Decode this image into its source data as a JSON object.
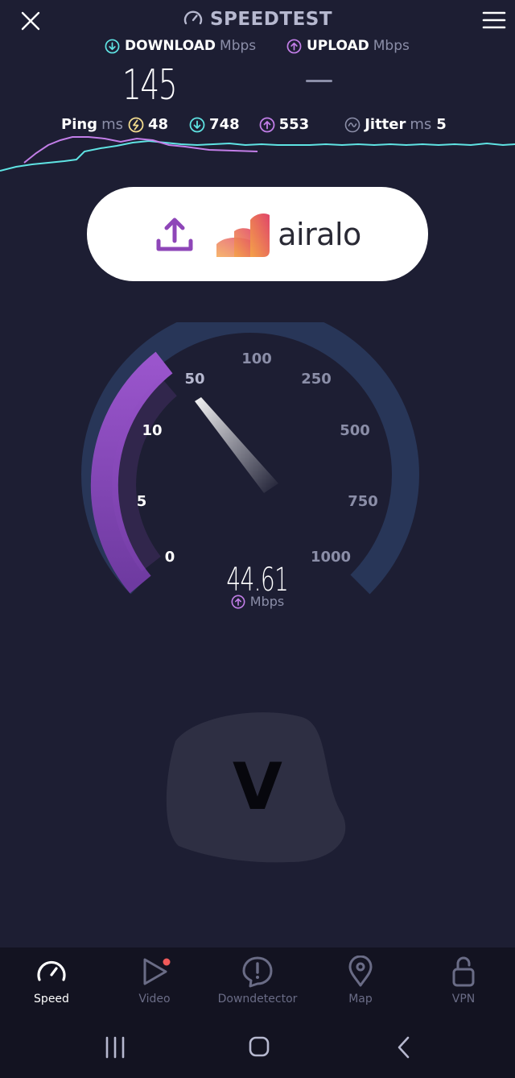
{
  "header": {
    "title": "SPEEDTEST",
    "close_icon": "close-icon",
    "menu_icon": "hamburger-menu-icon"
  },
  "results": {
    "download_label": "DOWNLOAD",
    "download_unit": "Mbps",
    "download_value": "145",
    "upload_label": "UPLOAD",
    "upload_unit": "Mbps",
    "upload_value": "—"
  },
  "stats": {
    "ping_label": "Ping",
    "ping_unit": "ms",
    "ping_value": "48",
    "download_ping": "748",
    "upload_ping": "553",
    "jitter_label": "Jitter",
    "jitter_unit": "ms",
    "jitter_value": "5"
  },
  "ad": {
    "brand": "airalo"
  },
  "gauge": {
    "ticks": [
      "0",
      "5",
      "10",
      "50",
      "100",
      "250",
      "500",
      "750",
      "1000"
    ],
    "current_value": "44.61",
    "unit": "Mbps",
    "colors": {
      "active": "#8e4fc0",
      "track": "#283658",
      "needle": "#ffffff"
    }
  },
  "blob": {
    "letter": "V"
  },
  "nav": {
    "items": [
      {
        "label": "Speed",
        "active": true
      },
      {
        "label": "Video",
        "active": false
      },
      {
        "label": "Downdetector",
        "active": false
      },
      {
        "label": "Map",
        "active": false
      },
      {
        "label": "VPN",
        "active": false
      }
    ]
  },
  "colors": {
    "background": "#1d1e33",
    "download_accent": "#5fe3e3",
    "upload_accent": "#c27ee8",
    "ping_accent": "#f3dc8e"
  }
}
